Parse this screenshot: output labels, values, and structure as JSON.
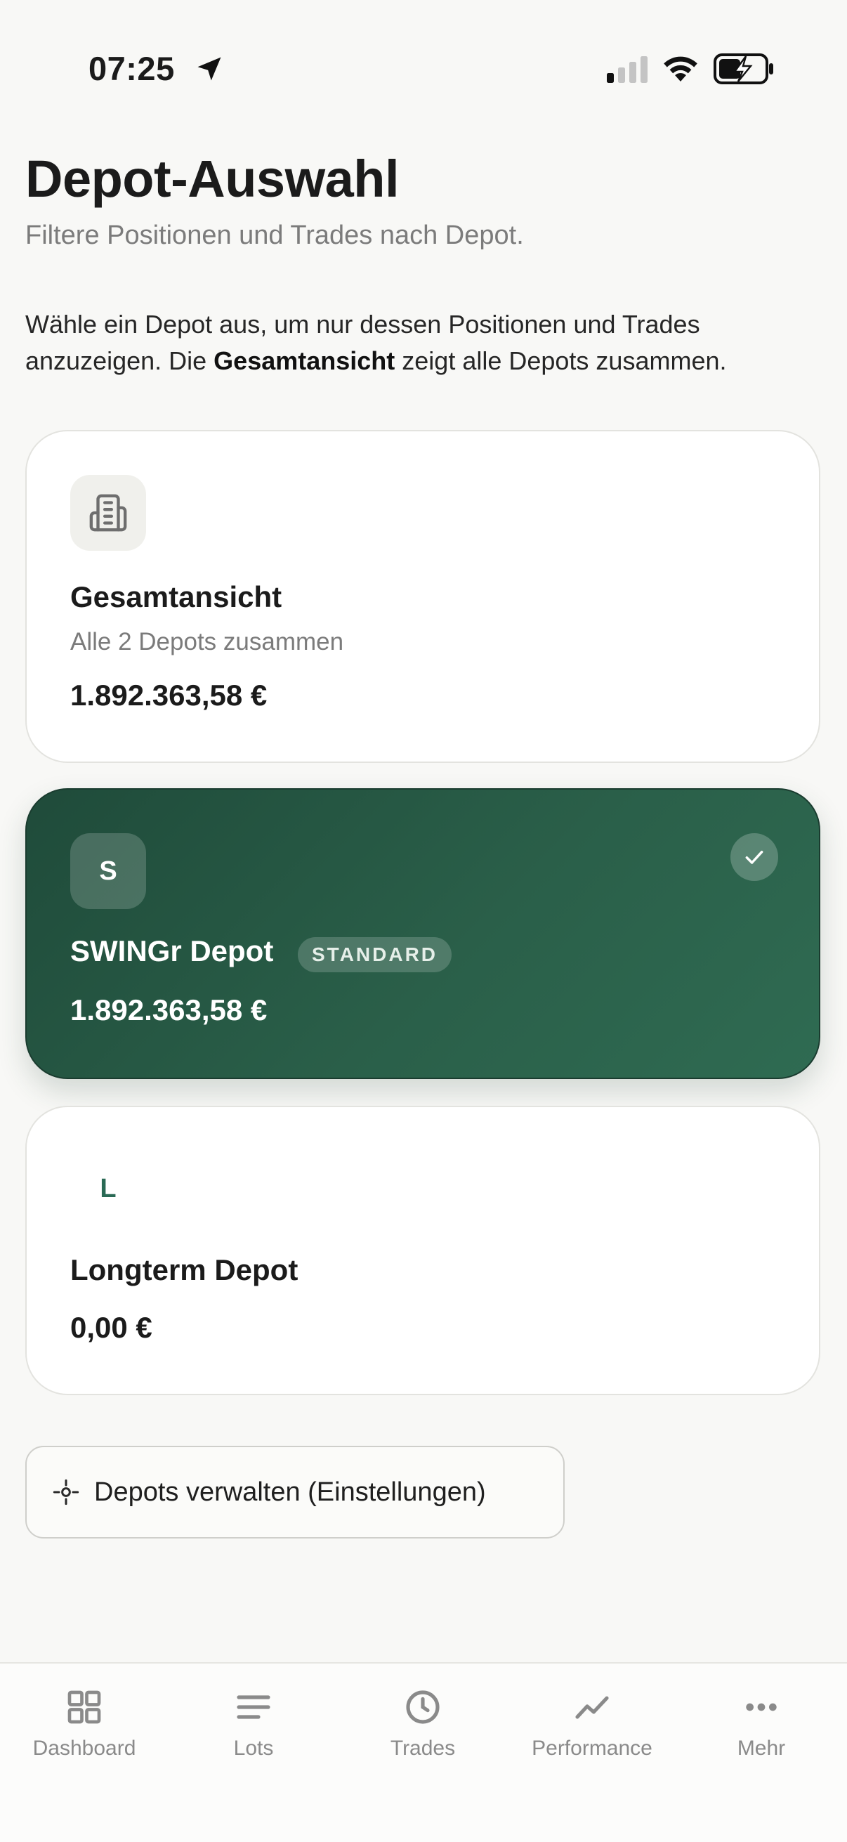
{
  "status_bar": {
    "time": "07:25"
  },
  "header": {
    "title": "Depot-Auswahl",
    "subtitle": "Filtere Positionen und Trades nach Depot.",
    "intro_part1": "Wähle ein Depot aus, um nur dessen Positionen und Trades anzuzeigen. Die ",
    "intro_bold": "Gesamtansicht",
    "intro_part2": " zeigt alle Depots zusammen."
  },
  "depots": {
    "total": {
      "name": "Gesamtansicht",
      "sub": "Alle 2 Depots zusammen",
      "value": "1.892.363,58 €",
      "icon": "building-icon"
    },
    "swing": {
      "initial": "S",
      "name": "SWINGr Depot",
      "badge": "STANDARD",
      "value": "1.892.363,58 €",
      "selected": true
    },
    "longterm": {
      "initial": "L",
      "name": "Longterm Depot",
      "value": "0,00 €"
    }
  },
  "manage_button": {
    "label": "Depots verwalten (Einstellungen)",
    "icon": "settings-icon"
  },
  "tabs": [
    {
      "label": "Dashboard",
      "icon": "grid-icon"
    },
    {
      "label": "Lots",
      "icon": "list-icon"
    },
    {
      "label": "Trades",
      "icon": "clock-icon"
    },
    {
      "label": "Performance",
      "icon": "trend-icon"
    },
    {
      "label": "Mehr",
      "icon": "more-icon"
    }
  ],
  "colors": {
    "accent": "#2a5f49",
    "background": "#f8f8f6"
  }
}
